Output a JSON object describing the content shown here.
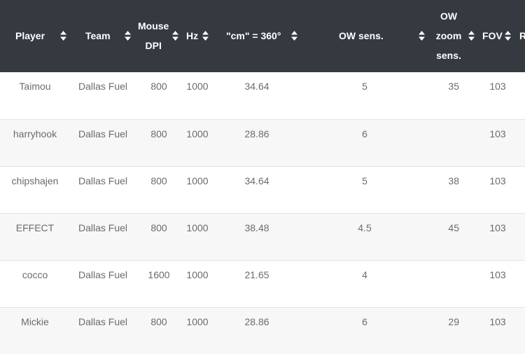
{
  "table": {
    "columns": [
      {
        "key": "player",
        "label_lines": [
          "Player"
        ]
      },
      {
        "key": "team",
        "label_lines": [
          "Team"
        ]
      },
      {
        "key": "dpi",
        "label_lines": [
          "Mouse",
          "DPI"
        ]
      },
      {
        "key": "hz",
        "label_lines": [
          "Hz"
        ]
      },
      {
        "key": "cm360",
        "label_lines": [
          "\"cm\" = 360°"
        ]
      },
      {
        "key": "ow_sens",
        "label_lines": [
          "OW sens."
        ]
      },
      {
        "key": "ow_zoom",
        "label_lines": [
          "OW",
          "zoom",
          "sens."
        ]
      },
      {
        "key": "fov",
        "label_lines": [
          "FOV"
        ]
      },
      {
        "key": "partial",
        "label_lines": [
          "R"
        ]
      }
    ],
    "sort_icon": "sort-updown-icon",
    "rows": [
      {
        "player": "Taimou",
        "team": "Dallas Fuel",
        "dpi": "800",
        "hz": "1000",
        "cm360": "34.64",
        "ow_sens": "5",
        "ow_zoom": "35",
        "fov": "103"
      },
      {
        "player": "harryhook",
        "team": "Dallas Fuel",
        "dpi": "800",
        "hz": "1000",
        "cm360": "28.86",
        "ow_sens": "6",
        "ow_zoom": "",
        "fov": "103"
      },
      {
        "player": "chipshajen",
        "team": "Dallas Fuel",
        "dpi": "800",
        "hz": "1000",
        "cm360": "34.64",
        "ow_sens": "5",
        "ow_zoom": "38",
        "fov": "103"
      },
      {
        "player": "EFFECT",
        "team": "Dallas Fuel",
        "dpi": "800",
        "hz": "1000",
        "cm360": "38.48",
        "ow_sens": "4.5",
        "ow_zoom": "45",
        "fov": "103"
      },
      {
        "player": "cocco",
        "team": "Dallas Fuel",
        "dpi": "1600",
        "hz": "1000",
        "cm360": "21.65",
        "ow_sens": "4",
        "ow_zoom": "",
        "fov": "103"
      },
      {
        "player": "Mickie",
        "team": "Dallas Fuel",
        "dpi": "800",
        "hz": "1000",
        "cm360": "28.86",
        "ow_sens": "6",
        "ow_zoom": "29",
        "fov": "103"
      }
    ]
  },
  "colors": {
    "header_bg": "#343a40",
    "header_text": "#ffffff",
    "cell_text": "#6b6b6b",
    "row_alt_bg": "#f7f7f7"
  }
}
